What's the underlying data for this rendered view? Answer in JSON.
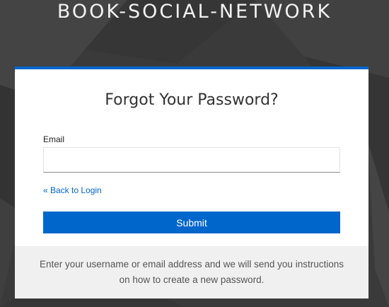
{
  "header": {
    "brand": "BOOK-SOCIAL-NETWORK"
  },
  "form": {
    "title": "Forgot Your Password?",
    "email_label": "Email",
    "email_value": "",
    "back_link": "« Back to Login",
    "submit_label": "Submit"
  },
  "info": {
    "text": "Enter your username or email address and we will send you instructions on how to create a new password."
  },
  "colors": {
    "accent": "#0066cc",
    "background": "#3b3b3b",
    "info_bg": "#f0f0f0"
  }
}
